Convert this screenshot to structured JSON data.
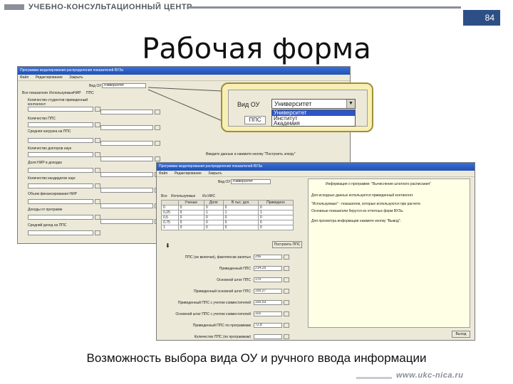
{
  "header": {
    "org_title": "УЧЕБНО-КОНСУЛЬТАЦИОННЫЙ ЦЕНТР",
    "page_number": "84",
    "slide_title": "Рабочая форма"
  },
  "window1": {
    "title": "Программа моделирования распределения показателей ВУЗа",
    "menu": [
      "Файл",
      "Редактирование",
      "Закрыть"
    ],
    "fields": [
      {
        "label": "Вид ОУ",
        "value": "Университет"
      }
    ],
    "tabs": [
      "Все показатели",
      "Используемые",
      "НИР",
      "ППС"
    ],
    "rows": [
      "Количество студентов приведенный контингент",
      "Количество ППС",
      "Средняя нагрузка на ППС",
      "Количество докторов наук",
      "Доля НИР в доходах",
      "Количество кандидатов наук",
      "Объем финансирования НИР",
      "Доходы от программ",
      "Средний доход на ППС"
    ],
    "status": "Введите данные и нажмите кнопку \"Построить эпюру\""
  },
  "zoom": {
    "label": "Вид ОУ",
    "selected": "Университет",
    "pps_label": "ППС",
    "options": [
      "Университет",
      "Институт",
      "Академия"
    ]
  },
  "window2": {
    "title": "Программа моделирования распределения показателей ВУЗа",
    "menu": [
      "Файл",
      "Редактирование",
      "Закрыть"
    ],
    "field_label": "Вид ОУ",
    "field_value": "Университет",
    "tabs": [
      "Все",
      "Используемые",
      "Из ИИС"
    ],
    "columns": [
      "",
      "Ученые",
      "Доля",
      "В тыс. дол.",
      "Приведено"
    ],
    "table_rows": [
      [
        "0",
        "0",
        "0",
        "0",
        "0"
      ],
      [
        "0,25",
        "0",
        "1",
        "1",
        "1"
      ],
      [
        "0,5",
        "0",
        "0",
        "0",
        "0"
      ],
      [
        "0,75",
        "0",
        "0",
        "0",
        "0"
      ],
      [
        "1",
        "0",
        "0",
        "0",
        "0"
      ]
    ],
    "build_button": "Построить ППС",
    "form_rows": [
      {
        "label": "ППС (не включая), фактически занятых",
        "value": "256"
      },
      {
        "label": "Приведенный ППС",
        "value": "214,25"
      },
      {
        "label": "Основной штат ППС",
        "value": "170"
      },
      {
        "label": "Приведенный основной штат ППС",
        "value": "100,27"
      },
      {
        "label": "Приведенный ППС с учетом совместителей",
        "value": "100,53"
      },
      {
        "label": "Основной штат ППС с учетом совместителей",
        "value": "102"
      },
      {
        "label": "Приведенный ППС по программам",
        "value": "72,8"
      },
      {
        "label": "Количество ППС (по программам)",
        "value": ""
      }
    ],
    "info_lines": [
      "Информация о программе: \"Вычисление штатного расписания\"",
      "Для исходных данных используется приведенный контингент.",
      "\"Используемые\" - показатели, которые используются при расчете.",
      "Основные показатели берутся из отчетных форм ВУЗа.",
      "Для просмотра информации нажмите кнопку \"Вывод\"."
    ],
    "exit_button": "Выход"
  },
  "caption": "Возможность выбора вида ОУ и ручного ввода информации",
  "footer_url": "www.ukc-nica.ru"
}
